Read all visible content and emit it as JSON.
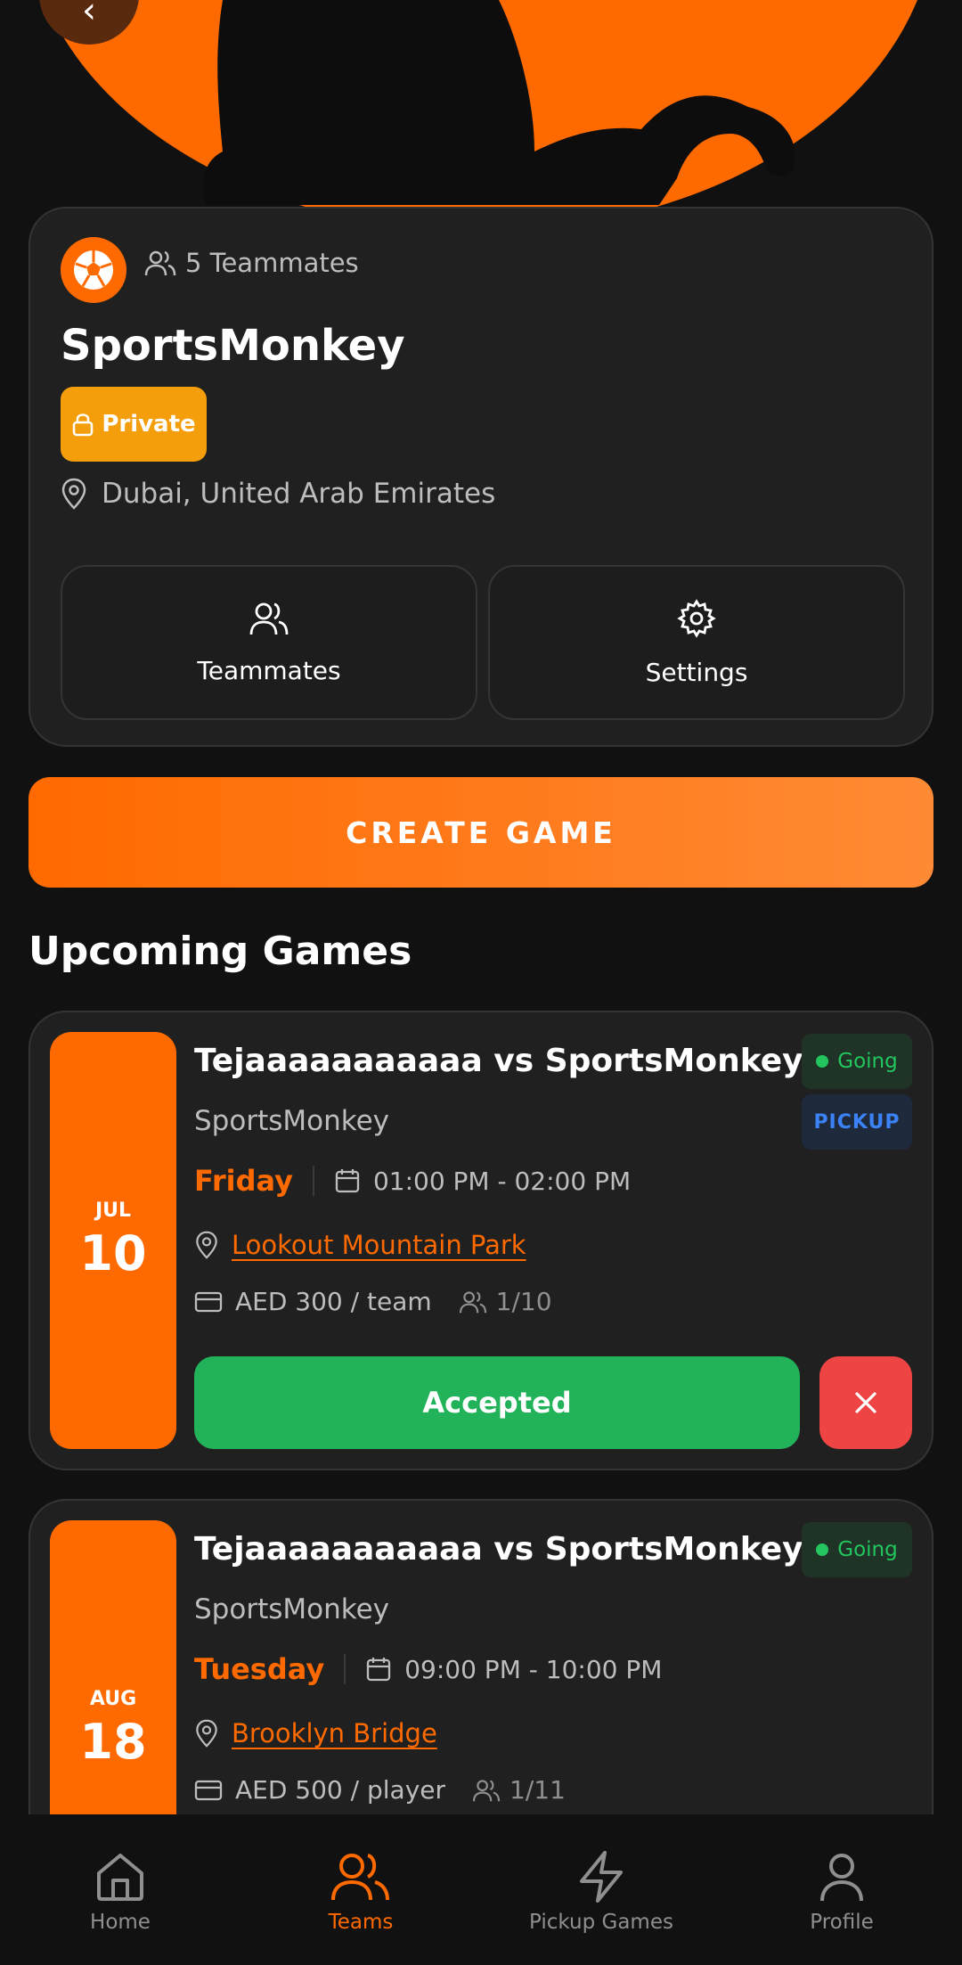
{
  "colors": {
    "accent": "#FF6A00",
    "card": "#202020",
    "going": "#22C55E",
    "pickup": "#3B82F6",
    "private": "#F59E0B",
    "accepted": "#22B35A",
    "decline": "#EF4444"
  },
  "team": {
    "teammates_count": "5 Teammates",
    "name": "SportsMonkey",
    "privacy": "Private",
    "location": "Dubai, United Arab Emirates",
    "actions": {
      "teammates": "Teammates",
      "settings": "Settings"
    }
  },
  "create_game_label": "CREATE GAME",
  "upcoming_title": "Upcoming Games",
  "games": [
    {
      "month": "JUL",
      "day": "10",
      "title": "Tejaaaaaaaaaaa vs SportsMonkey",
      "team": "SportsMonkey",
      "status": "Going",
      "type_badge": "PICKUP",
      "weekday": "Friday",
      "time": "01:00 PM - 02:00 PM",
      "venue": "Lookout Mountain Park",
      "price": "AED 300 / team",
      "players": "1/10",
      "accept_label": "Accepted"
    },
    {
      "month": "AUG",
      "day": "18",
      "title": "Tejaaaaaaaaaaa vs SportsMonkey",
      "team": "SportsMonkey",
      "status": "Going",
      "weekday": "Tuesday",
      "time": "09:00 PM - 10:00 PM",
      "venue": "Brooklyn Bridge",
      "price": "AED 500 / player",
      "players": "1/11"
    }
  ],
  "nav": {
    "home": "Home",
    "teams": "Teams",
    "pickup": "Pickup Games",
    "profile": "Profile",
    "active": "teams"
  }
}
